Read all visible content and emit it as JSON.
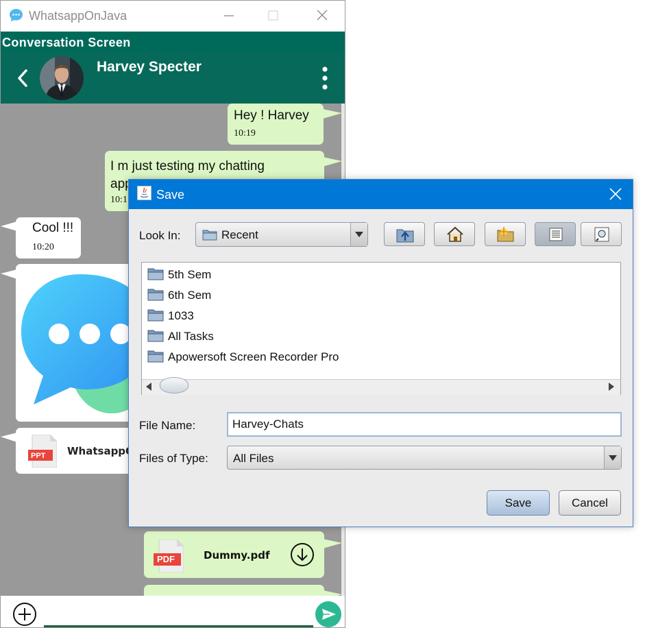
{
  "app": {
    "window_title": "WhatsappOnJava",
    "screen_label": "Conversation Screen",
    "contact_name": "Harvey Specter"
  },
  "messages": [
    {
      "direction": "out",
      "text": "Hey ! Harvey",
      "time": "10:19"
    },
    {
      "direction": "out",
      "text_line1": "I m just testing my chatting",
      "text_line2": "app",
      "time": "10:1"
    },
    {
      "direction": "in",
      "text": "Cool !!!",
      "time": "10:20"
    },
    {
      "direction": "in",
      "type": "image"
    },
    {
      "direction": "in",
      "type": "file",
      "badge": "PPT",
      "filename": "WhatsappO"
    },
    {
      "direction": "out",
      "type": "file",
      "badge": "PDF",
      "filename": "Dummy.pdf"
    }
  ],
  "dialog": {
    "title": "Save",
    "look_in_label": "Look In:",
    "look_in_value": "Recent",
    "toolbar": [
      "up-one-level-icon",
      "home-icon",
      "new-folder-icon",
      "list-view-icon",
      "details-view-icon"
    ],
    "files": [
      "5th Sem",
      "6th Sem",
      "1033",
      "All Tasks",
      "Apowersoft Screen Recorder Pro"
    ],
    "file_name_label": "File Name:",
    "file_name_value": "Harvey-Chats",
    "file_type_label": "Files of Type:",
    "file_type_value": "All Files",
    "save_label": "Save",
    "cancel_label": "Cancel"
  },
  "colors": {
    "header": "#07695a",
    "outgoing_bubble": "#dcf7c5",
    "incoming_bubble": "#ffffff",
    "chat_background": "#999999",
    "dialog_titlebar": "#0078d7",
    "send_button": "#2db894"
  }
}
